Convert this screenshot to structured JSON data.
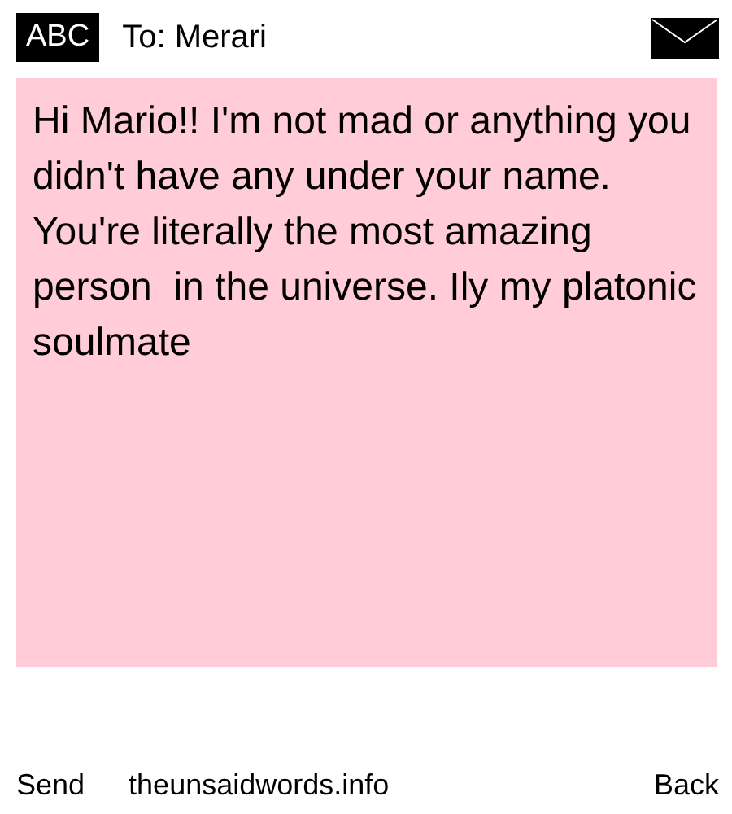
{
  "header": {
    "keyboard_mode": "ABC",
    "recipient": "To: Merari"
  },
  "message": "Hi Mario!! I'm not mad or anything you didn't have any under your name. You're literally the most amazing person  in the universe. Ily my platonic soulmate",
  "footer": {
    "send": "Send",
    "site": "theunsaidwords.info",
    "back": "Back"
  }
}
